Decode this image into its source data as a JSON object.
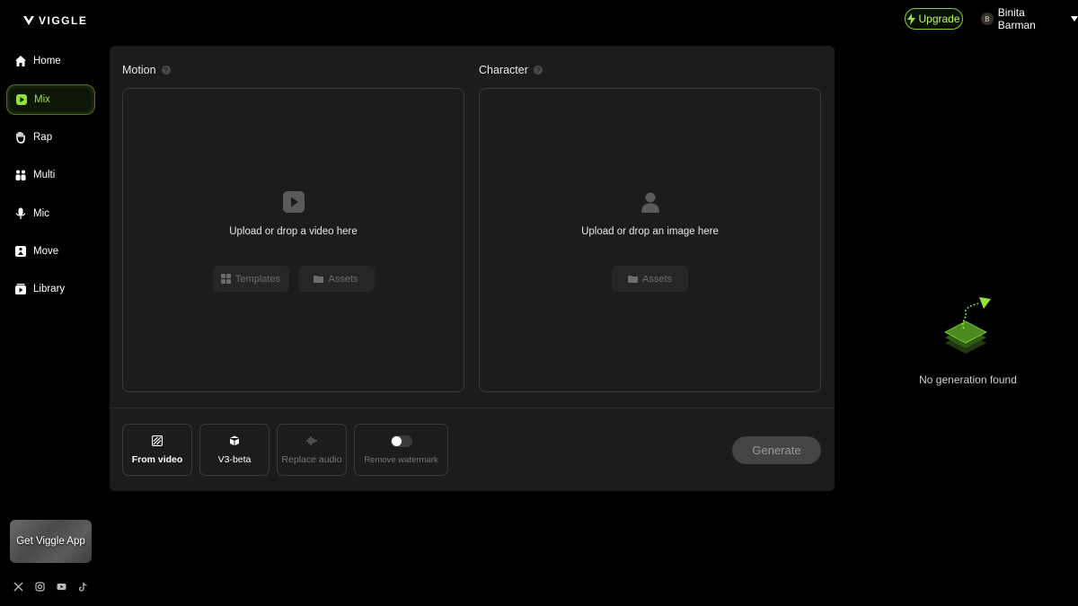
{
  "header": {
    "logo_text": "VIGGLE",
    "upgrade_label": "Upgrade",
    "user_initial": "B",
    "user_name": "Binita Barman"
  },
  "sidebar": {
    "items": [
      {
        "label": "Home",
        "icon": "home-icon",
        "active": false
      },
      {
        "label": "Mix",
        "icon": "mix-icon",
        "active": true
      },
      {
        "label": "Rap",
        "icon": "hand-icon",
        "active": false
      },
      {
        "label": "Multi",
        "icon": "multi-icon",
        "active": false
      },
      {
        "label": "Mic",
        "icon": "mic-icon",
        "active": false
      },
      {
        "label": "Move",
        "icon": "move-icon",
        "active": false
      },
      {
        "label": "Library",
        "icon": "library-icon",
        "active": false
      }
    ],
    "app_card_label": "Get Viggle App",
    "socials": [
      "x-icon",
      "instagram-icon",
      "youtube-icon",
      "tiktok-icon"
    ]
  },
  "main": {
    "motion": {
      "title": "Motion",
      "drop_text": "Upload or drop a video here",
      "buttons": [
        "Templates",
        "Assets"
      ]
    },
    "character": {
      "title": "Character",
      "drop_text": "Upload or drop an image here",
      "buttons": [
        "Assets"
      ]
    },
    "options": {
      "from_video": "From video",
      "v3_beta": "V3-beta",
      "replace_audio": "Replace audio",
      "remove_watermark": "Remove watermark",
      "watermark_toggle_on": false
    },
    "generate_label": "Generate"
  },
  "results": {
    "empty_text": "No generation found"
  },
  "colors": {
    "accent": "#8fe33a",
    "panel_bg": "#1c1c1c",
    "page_bg": "#000000"
  }
}
